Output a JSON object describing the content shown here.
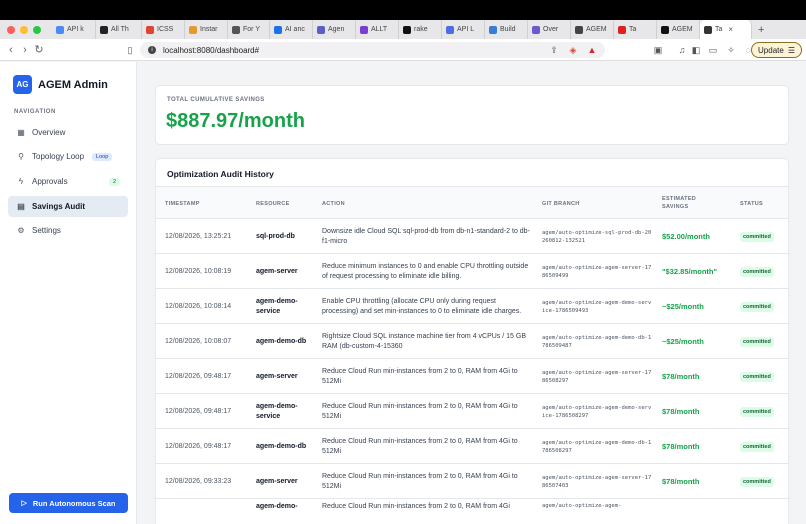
{
  "browser": {
    "tabs": [
      {
        "label": "API k",
        "color": "#4b8bf5"
      },
      {
        "label": "All Th",
        "color": "#222222"
      },
      {
        "label": "ICSS",
        "color": "#e0442f"
      },
      {
        "label": "Instar",
        "color": "#e59a2a"
      },
      {
        "label": "For Y",
        "color": "#555555"
      },
      {
        "label": "AI anc",
        "color": "#1a73e8"
      },
      {
        "label": "Agen",
        "color": "#5b5fc7"
      },
      {
        "label": "ALLT",
        "color": "#7a3fd1"
      },
      {
        "label": "rake",
        "color": "#111111"
      },
      {
        "label": "API L",
        "color": "#4b6ee8"
      },
      {
        "label": "Build",
        "color": "#3a7bd5"
      },
      {
        "label": "Over",
        "color": "#6a5acd"
      },
      {
        "label": "AGEM",
        "color": "#444444"
      },
      {
        "label": "Ta",
        "color": "#e02020"
      },
      {
        "label": "AGEM",
        "color": "#111111"
      },
      {
        "label": "Ta",
        "color": "#333333"
      }
    ],
    "url": "localhost:8080/dashboard#",
    "update_label": "Update"
  },
  "sidebar": {
    "logo_text": "AG",
    "brand_name": "AGEM Admin",
    "nav_heading": "NAVIGATION",
    "items": [
      {
        "label": "Overview",
        "icon": "grid-icon"
      },
      {
        "label": "Topology Loop",
        "icon": "topology-icon",
        "badge": "Loop"
      },
      {
        "label": "Approvals",
        "icon": "bolt-icon",
        "badge": "2"
      },
      {
        "label": "Savings Audit",
        "icon": "document-icon"
      },
      {
        "label": "Settings",
        "icon": "gear-icon"
      }
    ],
    "scan_button": "Run Autonomous Scan"
  },
  "savings": {
    "label": "TOTAL CUMULATIVE SAVINGS",
    "value": "$887.97/month"
  },
  "audit": {
    "title": "Optimization Audit History",
    "columns": [
      "TIMESTAMP",
      "RESOURCE",
      "ACTION",
      "GIT BRANCH",
      "ESTIMATED SAVINGS",
      "STATUS"
    ],
    "rows": [
      {
        "timestamp": "12/08/2026, 13:25:21",
        "resource": "sql-prod-db",
        "action": "Downsize idle Cloud SQL sql-prod-db from db-n1-standard-2 to db-f1-micro",
        "branch": "agem/auto-optimize-sql-prod-db-20260812-132521",
        "savings": "$52.00/month",
        "status": "committed"
      },
      {
        "timestamp": "12/08/2026, 10:08:19",
        "resource": "agem-server",
        "action": "Reduce minimum instances to 0 and enable CPU throttling outside of request processing to eliminate idle billing.",
        "branch": "agem/auto-optimize-agem-server-1786509499",
        "savings": "\"$32.85/month\"",
        "status": "committed"
      },
      {
        "timestamp": "12/08/2026, 10:08:14",
        "resource": "agem-demo-service",
        "action": "Enable CPU throttling (allocate CPU only during request processing) and set min-instances to 0 to eliminate idle charges.",
        "branch": "agem/auto-optimize-agem-demo-service-1786509493",
        "savings": "~$25/month",
        "status": "committed"
      },
      {
        "timestamp": "12/08/2026, 10:08:07",
        "resource": "agem-demo-db",
        "action": "Rightsize Cloud SQL instance machine tier from 4 vCPUs / 15 GB RAM (db-custom-4-15360",
        "branch": "agem/auto-optimize-agem-demo-db-1786509487",
        "savings": "~$25/month",
        "status": "committed"
      },
      {
        "timestamp": "12/08/2026, 09:48:17",
        "resource": "agem-server",
        "action": "Reduce Cloud Run min-instances from 2 to 0, RAM from 4Gi to 512Mi",
        "branch": "agem/auto-optimize-agem-server-1786508297",
        "savings": "$78/month",
        "status": "committed"
      },
      {
        "timestamp": "12/08/2026, 09:48:17",
        "resource": "agem-demo-service",
        "action": "Reduce Cloud Run min-instances from 2 to 0, RAM from 4Gi to 512Mi",
        "branch": "agem/auto-optimize-agem-demo-service-1786508297",
        "savings": "$78/month",
        "status": "committed"
      },
      {
        "timestamp": "12/08/2026, 09:48:17",
        "resource": "agem-demo-db",
        "action": "Reduce Cloud Run min-instances from 2 to 0, RAM from 4Gi to 512Mi",
        "branch": "agem/auto-optimize-agem-demo-db-1786508297",
        "savings": "$78/month",
        "status": "committed"
      },
      {
        "timestamp": "12/08/2026, 09:33:23",
        "resource": "agem-server",
        "action": "Reduce Cloud Run min-instances from 2 to 0, RAM from 4Gi to 512Mi",
        "branch": "agem/auto-optimize-agem-server-1786507403",
        "savings": "$78/month",
        "status": "committed"
      },
      {
        "timestamp": "",
        "resource": "agem-demo-",
        "action": "Reduce Cloud Run min-instances from 2 to 0, RAM from 4Gi",
        "branch": "agem/auto-optimize-agem-",
        "savings": "",
        "status": ""
      }
    ]
  }
}
